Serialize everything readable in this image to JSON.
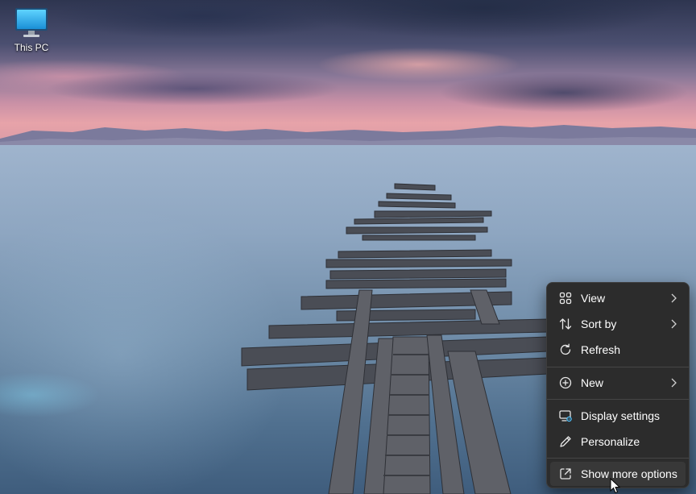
{
  "desktop": {
    "icons": [
      {
        "label": "This PC",
        "icon": "monitor-icon"
      }
    ]
  },
  "context_menu": {
    "items": [
      {
        "label": "View",
        "icon": "grid-icon",
        "submenu": true
      },
      {
        "label": "Sort by",
        "icon": "sort-arrows-icon",
        "submenu": true
      },
      {
        "label": "Refresh",
        "icon": "refresh-icon",
        "submenu": false
      },
      {
        "label": "New",
        "icon": "plus-circle-icon",
        "submenu": true
      },
      {
        "label": "Display settings",
        "icon": "display-settings-icon",
        "submenu": false
      },
      {
        "label": "Personalize",
        "icon": "pen-icon",
        "submenu": false
      },
      {
        "label": "Show more options",
        "icon": "open-external-icon",
        "submenu": false,
        "hovered": true
      }
    ]
  },
  "colors": {
    "menu_background": "#2c2c2c",
    "menu_hover": "#383838",
    "menu_text": "#ffffff",
    "accent": "#4cc2ff"
  }
}
